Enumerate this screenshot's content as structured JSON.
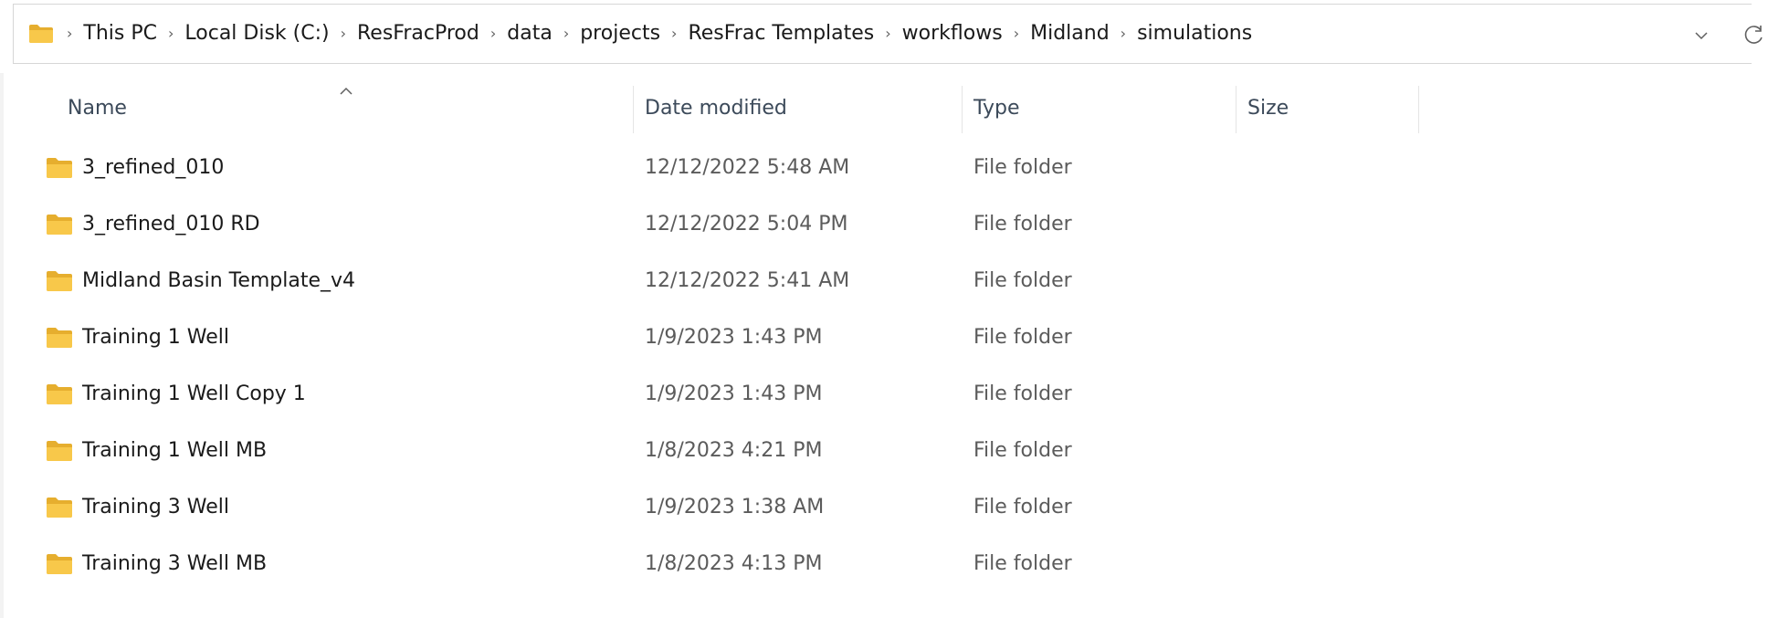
{
  "address_bar": {
    "icon": "folder-icon",
    "breadcrumbs": [
      "This PC",
      "Local Disk (C:)",
      "ResFracProd",
      "data",
      "projects",
      "ResFrac Templates",
      "workflows",
      "Midland",
      "simulations"
    ],
    "separator": "›"
  },
  "columns": {
    "name": "Name",
    "date_modified": "Date modified",
    "type": "Type",
    "size": "Size"
  },
  "files": [
    {
      "name": "3_refined_010",
      "date": "12/12/2022 5:48 AM",
      "type": "File folder",
      "size": ""
    },
    {
      "name": "3_refined_010 RD",
      "date": "12/12/2022 5:04 PM",
      "type": "File folder",
      "size": ""
    },
    {
      "name": "Midland Basin Template_v4",
      "date": "12/12/2022 5:41 AM",
      "type": "File folder",
      "size": ""
    },
    {
      "name": "Training 1 Well",
      "date": "1/9/2023 1:43 PM",
      "type": "File folder",
      "size": ""
    },
    {
      "name": "Training 1 Well Copy 1",
      "date": "1/9/2023 1:43 PM",
      "type": "File folder",
      "size": ""
    },
    {
      "name": "Training 1 Well MB",
      "date": "1/8/2023 4:21 PM",
      "type": "File folder",
      "size": ""
    },
    {
      "name": "Training 3 Well",
      "date": "1/9/2023 1:38 AM",
      "type": "File folder",
      "size": ""
    },
    {
      "name": "Training 3 Well MB",
      "date": "1/8/2023 4:13 PM",
      "type": "File folder",
      "size": ""
    }
  ],
  "colors": {
    "folder": "#F8C84A",
    "folder_dark": "#E6AE2E",
    "header_text": "#3c4a5a",
    "secondary_text": "#5b5b5b"
  }
}
